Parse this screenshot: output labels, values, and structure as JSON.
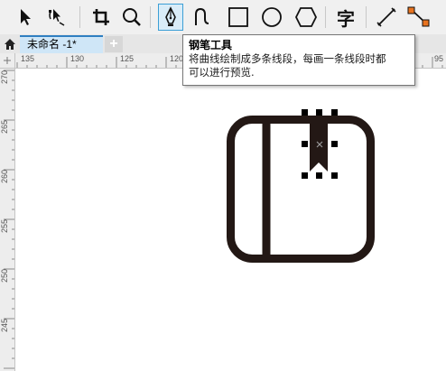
{
  "toolbar": {
    "tools": [
      {
        "icon": "pick-tool-icon"
      },
      {
        "icon": "shape-edit-tool-icon"
      },
      {
        "icon": "crop-tool-icon"
      },
      {
        "icon": "zoom-tool-icon"
      },
      {
        "icon": "pen-tool-icon",
        "active": true
      },
      {
        "icon": "freehand-tool-icon"
      },
      {
        "icon": "rectangle-tool-icon"
      },
      {
        "icon": "ellipse-tool-icon"
      },
      {
        "icon": "polygon-tool-icon"
      },
      {
        "icon": "text-tool-icon",
        "label": "字"
      },
      {
        "icon": "line-dimension-tool-icon"
      },
      {
        "icon": "connector-tool-icon"
      }
    ],
    "accent_color": "#3c9fd6"
  },
  "tabs": {
    "home_icon": "home-icon",
    "document_tab_label": "未命名 -1*",
    "add_tab_label": "+"
  },
  "ruler_h": {
    "labels": [
      "135",
      "130",
      "125",
      "120",
      "95"
    ]
  },
  "ruler_v": {
    "labels": [
      "270",
      "265",
      "260",
      "255",
      "250",
      "245"
    ]
  },
  "tooltip": {
    "title": "钢笔工具",
    "line1": "将曲线绘制成多条线段，每画一条线段时都",
    "line2": "可以进行预览."
  },
  "canvas": {
    "object_icon": "bookmark-book-icon",
    "stroke_color": "#231815"
  }
}
